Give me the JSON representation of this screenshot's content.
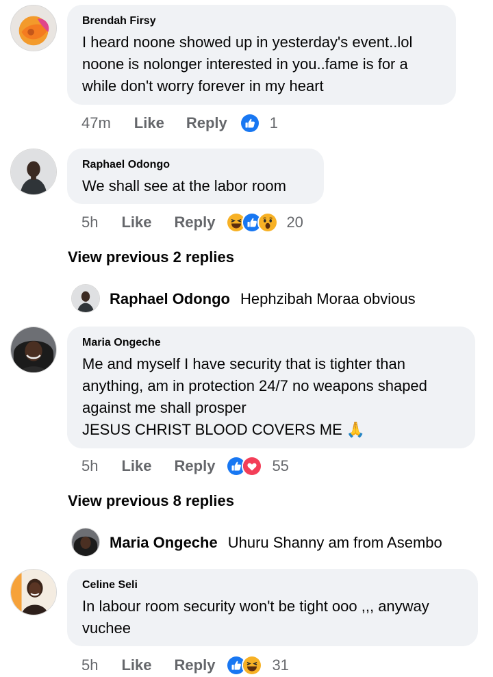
{
  "comments": [
    {
      "author": "Brendah Firsy",
      "text": "I heard noone showed up in yesterday's event..lol\nnoone is nolonger interested in you..fame is for a\nwhile don't worry forever in my heart",
      "time": "47m",
      "like_label": "Like",
      "reply_label": "Reply",
      "reactions": [
        "like-reaction-icon"
      ],
      "reaction_count": "1"
    },
    {
      "author": "Raphael Odongo",
      "text": "We shall see at the labor room",
      "time": "5h",
      "like_label": "Like",
      "reply_label": "Reply",
      "reactions": [
        "haha-reaction-icon",
        "like-reaction-icon",
        "wow-reaction-icon"
      ],
      "reaction_count": "20",
      "view_previous": "View previous 2 replies",
      "reply": {
        "author": "Raphael Odongo",
        "text": "Hephzibah Moraa obvious"
      }
    },
    {
      "author": "Maria Ongeche",
      "text": "Me and myself I have security that is tighter than\nanything, am in protection 24/7 no weapons shaped\nagainst me shall prosper\nJESUS CHRIST BLOOD COVERS ME",
      "emoji": "🙏",
      "time": "5h",
      "like_label": "Like",
      "reply_label": "Reply",
      "reactions": [
        "like-reaction-icon",
        "love-reaction-icon"
      ],
      "reaction_count": "55",
      "view_previous": "View previous 8 replies",
      "reply": {
        "author": "Maria Ongeche",
        "text": "Uhuru Shanny am from Asembo"
      }
    },
    {
      "author": "Celine Seli",
      "text": "In labour room security won't be tight ooo ,,,  anyway\nvuchee",
      "time": "5h",
      "like_label": "Like",
      "reply_label": "Reply",
      "reactions": [
        "like-reaction-icon",
        "haha-reaction-icon"
      ],
      "reaction_count": "31"
    }
  ],
  "colors": {
    "bubble": "#f0f2f5",
    "meta_text": "#65676b",
    "like_blue": "#1877f2",
    "love_red": "#f33e58",
    "haha_yellow": "#f7b125"
  }
}
